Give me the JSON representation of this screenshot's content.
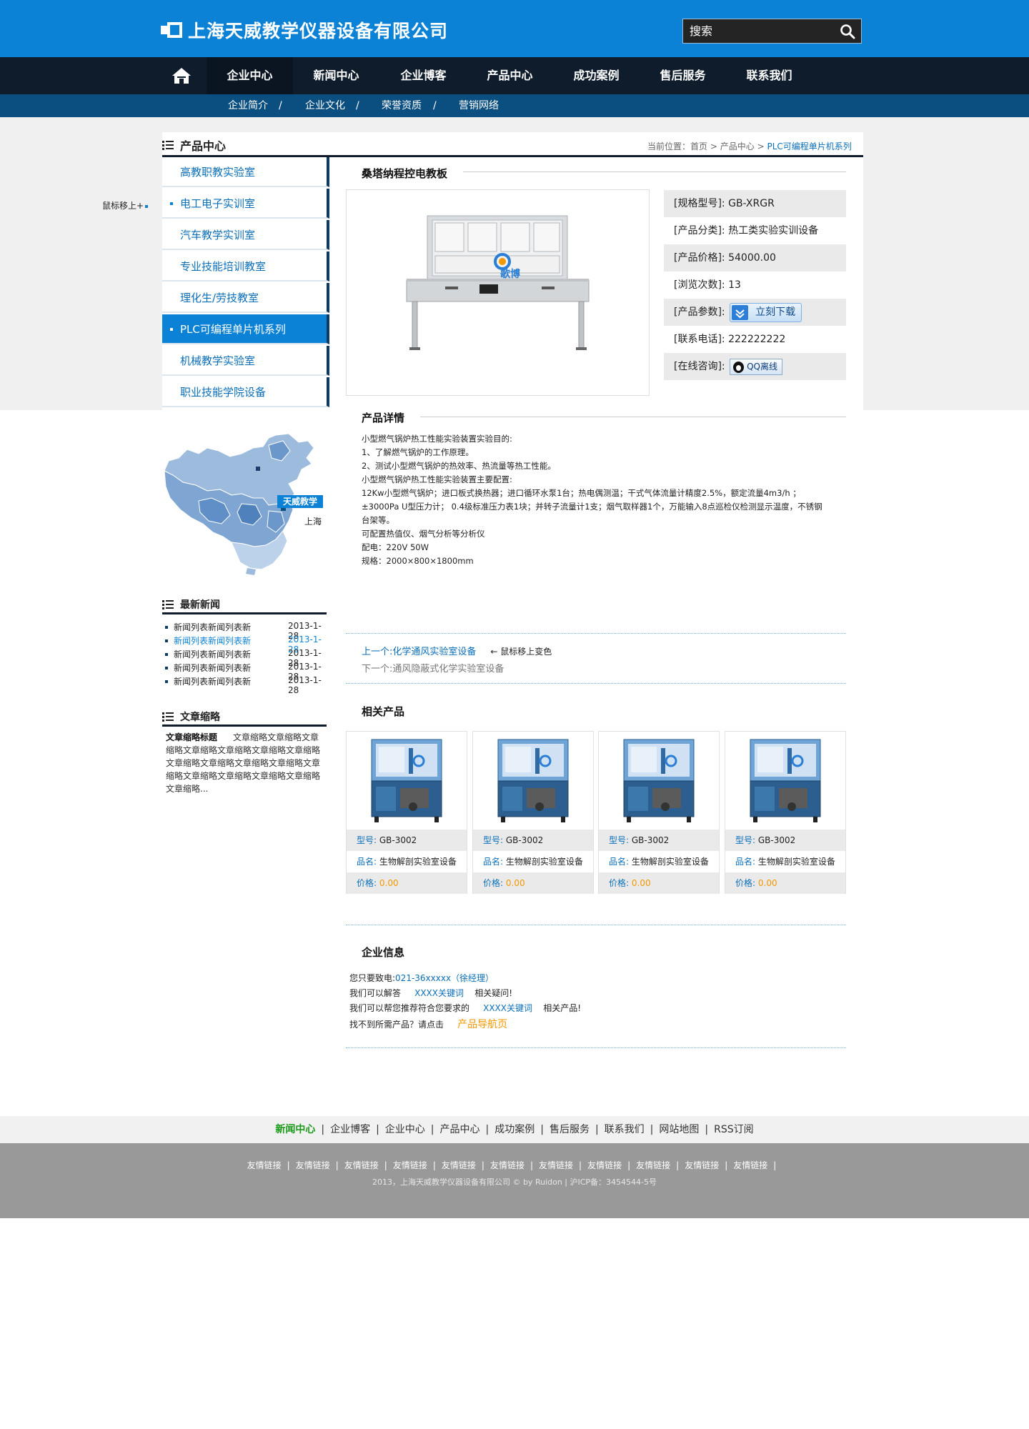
{
  "header": {
    "company": "上海天威教学仪器设备有限公司",
    "search_placeholder": "搜索"
  },
  "nav": {
    "items": [
      "企业中心",
      "新闻中心",
      "企业博客",
      "产品中心",
      "成功案例",
      "售后服务",
      "联系我们"
    ],
    "active": "企业中心"
  },
  "subnav": {
    "items": [
      "企业简介",
      "企业文化",
      "荣誉资质",
      "营销网络"
    ],
    "sep": "/"
  },
  "sidebar": {
    "title": "产品中心",
    "hover_note": "鼠标移上+",
    "items": [
      "高教职教实验室",
      "电工电子实训室",
      "汽车教学实训室",
      "专业技能培训教室",
      "理化生/劳技教室",
      "PLC可编程单片机系列",
      "机械教学实验室",
      "职业技能学院设备"
    ],
    "active_index": 5
  },
  "breadcrumb": {
    "label": "当前位置：",
    "items": [
      "首页",
      "产品中心",
      "PLC可编程单片机系列"
    ]
  },
  "product": {
    "title": "桑塔纳程控电教板",
    "image_brand": "歌博",
    "attrs": [
      {
        "label": "[规格型号]:",
        "value": "GB-XRGR"
      },
      {
        "label": "[产品分类]:",
        "value": "热工类实验实训设备"
      },
      {
        "label": "[产品价格]:",
        "value": "54000.00"
      },
      {
        "label": "[浏览次数]:",
        "value": "13"
      },
      {
        "label": "[产品参数]:",
        "value": ""
      },
      {
        "label": "[联系电话]:",
        "value": "222222222"
      },
      {
        "label": "[在线咨询]:",
        "value": ""
      }
    ],
    "download_label": "立刻下载",
    "qq_label": "QQ离线"
  },
  "detail": {
    "title": "产品详情",
    "lines": [
      "小型燃气锅炉热工性能实验装置实验目的:",
      "1、了解燃气锅炉的工作原理。",
      "2、测试小型燃气锅炉的热效率、热流量等热工性能。",
      "小型燃气锅炉热工性能实验装置主要配置:",
      "12Kw小型燃气锅炉；进口板式换热器；进口循环水泵1台；热电偶测温；干式气体流量计精度2.5%，额定流量4m3/h ；",
      "±3000Pa U型压力计； 0.4级标准压力表1块；并转子流量计1支；烟气取样器1个，万能输入8点巡检仪检测显示温度，不锈钢",
      "台架等。",
      "可配置热值仪、烟气分析等分析仪",
      "配电：220V 50W",
      "规格：2000×800×1800mm"
    ]
  },
  "pager": {
    "prev_label": "上一个:",
    "prev": "化学通风实验室设备",
    "hover_note": "鼠标移上变色",
    "next_label": "下一个:",
    "next": "通风隐蔽式化学实验室设备"
  },
  "related": {
    "title": "相关产品",
    "items": [
      {
        "model_label": "型号:",
        "model": "GB-3002",
        "name_label": "品名:",
        "name": "生物解剖实验室设备",
        "price_label": "价格:",
        "price": "0.00"
      },
      {
        "model_label": "型号:",
        "model": "GB-3002",
        "name_label": "品名:",
        "name": "生物解剖实验室设备",
        "price_label": "价格:",
        "price": "0.00"
      },
      {
        "model_label": "型号:",
        "model": "GB-3002",
        "name_label": "品名:",
        "name": "生物解剖实验室设备",
        "price_label": "价格:",
        "price": "0.00"
      },
      {
        "model_label": "型号:",
        "model": "GB-3002",
        "name_label": "品名:",
        "name": "生物解剖实验室设备",
        "price_label": "价格:",
        "price": "0.00"
      }
    ]
  },
  "map": {
    "badge": "天威教学",
    "city": "上海"
  },
  "news": {
    "title": "最新新闻",
    "items": [
      {
        "title": "新闻列表新闻列表新",
        "date": "2013-1-28"
      },
      {
        "title": "新闻列表新闻列表新",
        "date": "2013-1-28"
      },
      {
        "title": "新闻列表新闻列表新",
        "date": "2013-1-28"
      },
      {
        "title": "新闻列表新闻列表新",
        "date": "2013-1-28"
      },
      {
        "title": "新闻列表新闻列表新",
        "date": "2013-1-28"
      }
    ],
    "highlight_index": 1
  },
  "abstract": {
    "title": "文章缩略",
    "heading": "文章缩略标题",
    "text": "文章缩略文章缩略文章缩略文章缩略文章缩略文章缩略文章缩略文章缩略文章缩略文章缩略文章缩略文章缩略文章缩略文章缩略文章缩略文章缩略文章缩略..."
  },
  "company_info": {
    "title": "企业信息",
    "l1_a": "您只要致电:",
    "l1_phone": "021-36xxxxx（徐经理）",
    "l2_a": "我们可以解答",
    "l2_kw": "XXXX关键词",
    "l2_b": "相关疑问!",
    "l3_a": "我们可以帮您推荐符合您要求的",
    "l3_kw": "XXXX关键词",
    "l3_b": "相关产品!",
    "l4_a": "找不到所需产品？请点击",
    "l4_link": "产品导航页"
  },
  "footer": {
    "nav": [
      "新闻中心",
      "企业博客",
      "企业中心",
      "产品中心",
      "成功案例",
      "售后服务",
      "联系我们",
      "网站地图",
      "RSS订阅"
    ],
    "active": "新闻中心",
    "links": [
      "友情链接",
      "友情链接",
      "友情链接",
      "友情链接",
      "友情链接",
      "友情链接",
      "友情链接",
      "友情链接",
      "友情链接",
      "友情链接",
      "友情链接"
    ],
    "copyright": "2013，上海天威教学仪器设备有限公司 © by Ruidon | 沪ICP备：3454544-5号"
  },
  "colors": {
    "brand": "#0c82d7",
    "nav": "#0e1c2b",
    "subnav": "#0b4f80",
    "accent": "#f39800",
    "link": "#0b6fb8"
  }
}
